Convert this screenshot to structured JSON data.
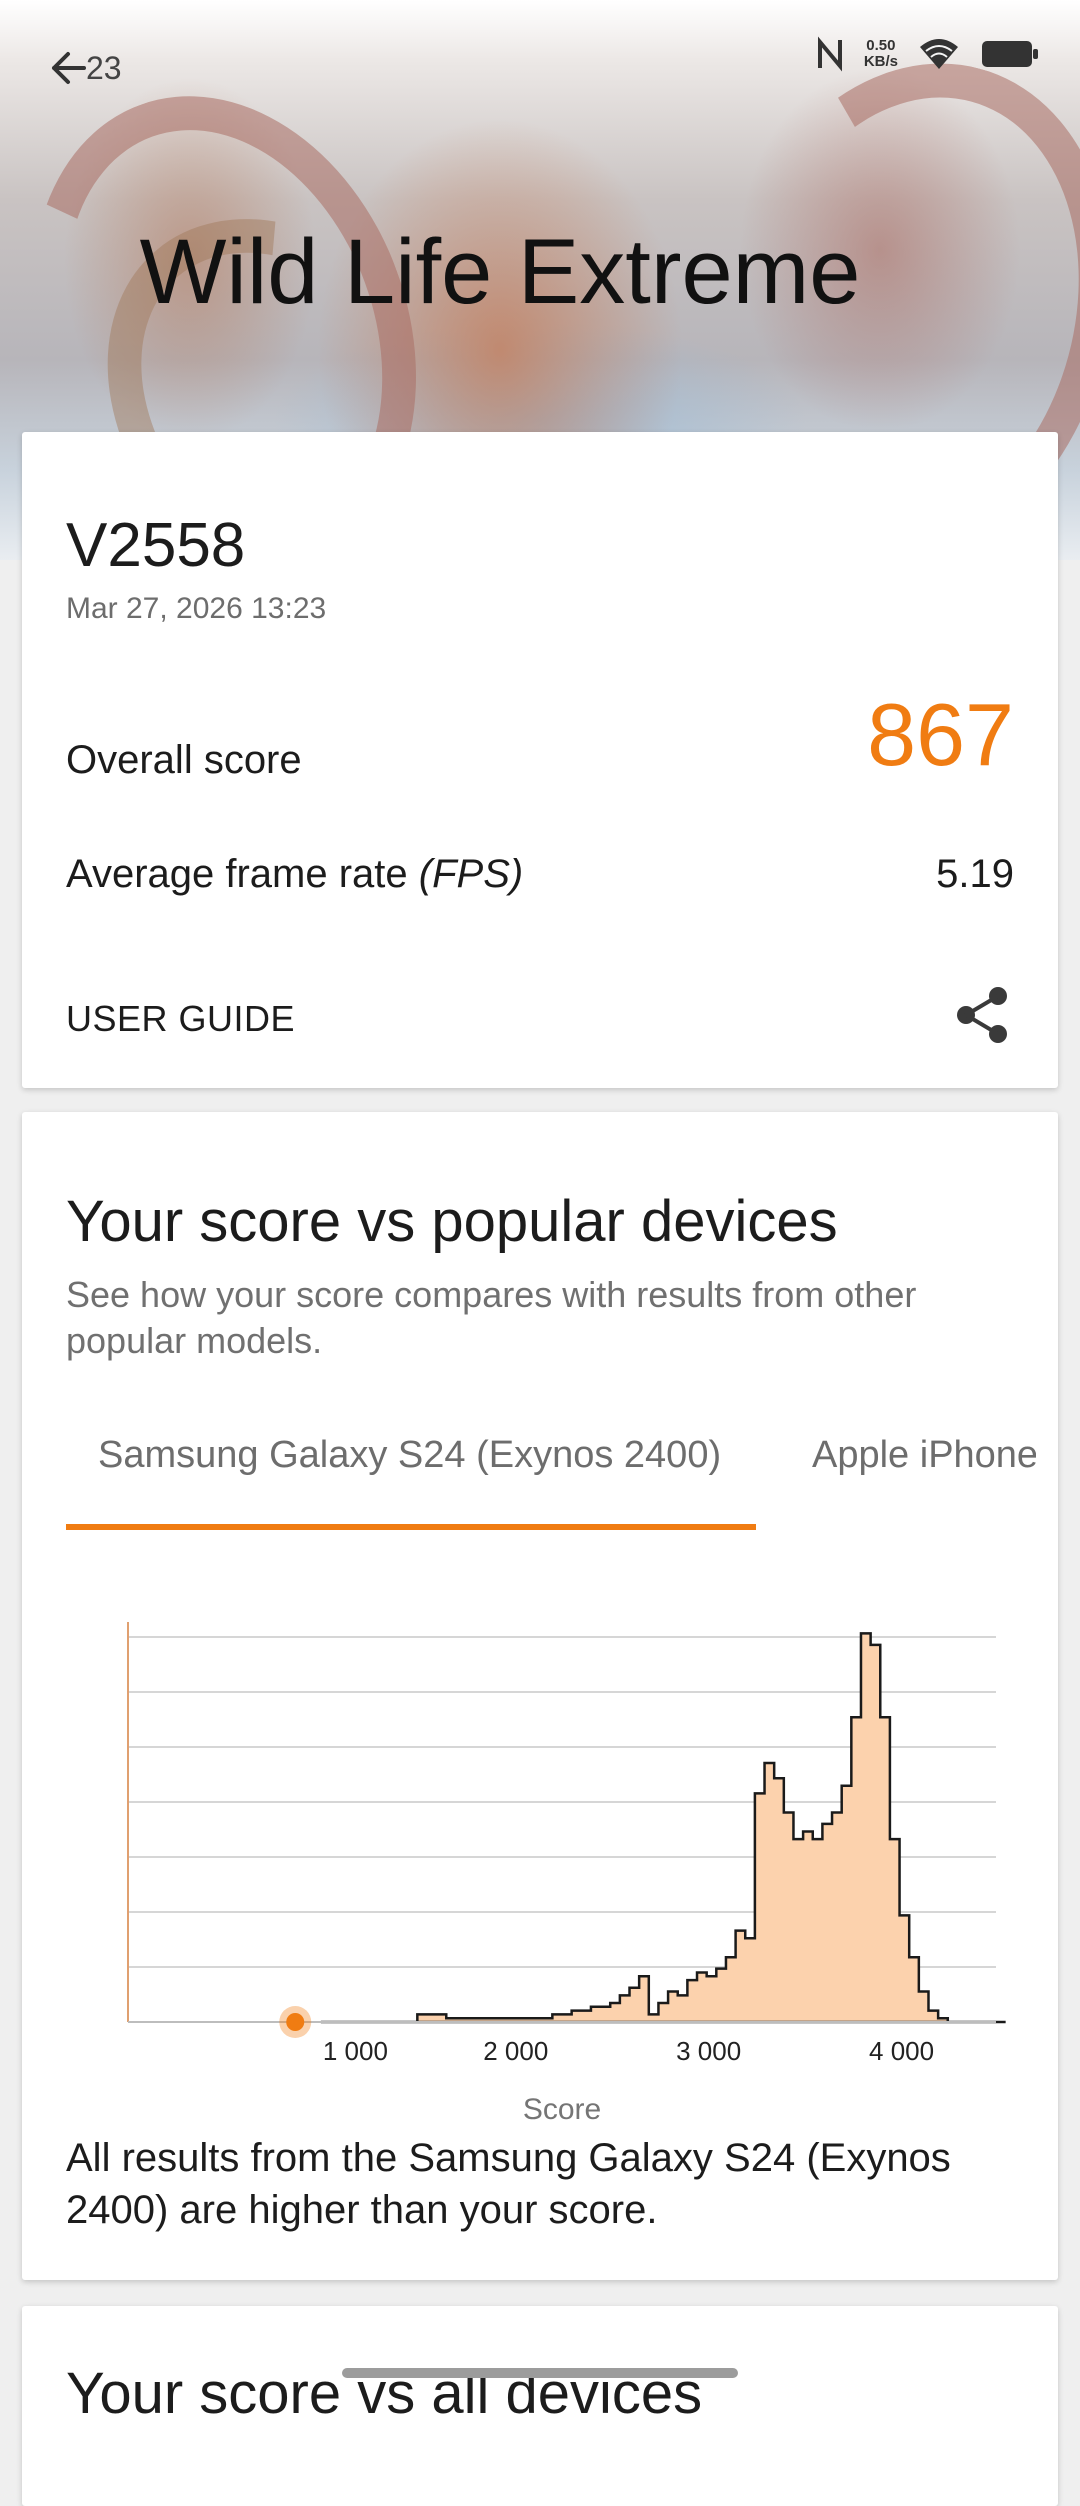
{
  "status_bar": {
    "time": "23",
    "net_speed_value": "0.50",
    "net_speed_unit": "KB/s",
    "icons": [
      "nfc-icon",
      "wifi-icon",
      "battery-icon"
    ]
  },
  "header": {
    "title": "Wild Life Extreme",
    "back_icon": "arrow-left-icon",
    "share_icon": "share-icon"
  },
  "result": {
    "device": "V2558",
    "date": "Mar 27, 2026 13:23",
    "overall_label": "Overall score",
    "overall_value": "867",
    "fps_label": "Average frame rate",
    "fps_unit": "(FPS)",
    "fps_value": "5.19",
    "user_guide": "USER GUIDE",
    "accent_color": "#f07c12"
  },
  "comparison": {
    "title": "Your score vs popular devices",
    "description": "See how your score compares with results from other popular models.",
    "tabs": [
      {
        "label": "Samsung Galaxy S24 (Exynos 2400)",
        "selected": true
      },
      {
        "label": "Apple iPhone",
        "selected": false
      }
    ],
    "note": "All results from the Samsung Galaxy S24 (Exynos 2400) are higher than your score."
  },
  "chart_data": {
    "type": "area",
    "title": "",
    "xlabel": "Score",
    "ylabel": "",
    "xlim": [
      0.0,
      4500
    ],
    "ylim": [
      0,
      105
    ],
    "x_ticks": [
      1000,
      2000,
      3000,
      4000
    ],
    "x_tick_labels": [
      "1 000",
      "2 000",
      "3 000",
      "4 000"
    ],
    "grid": true,
    "fill_color": "#fcd2ad",
    "line_color": "#1a1a1a",
    "your_score": 867,
    "marker_color": "#f07c12",
    "x": [
      1000,
      1500,
      1650,
      2000,
      2200,
      2300,
      2400,
      2450,
      2500,
      2550,
      2600,
      2650,
      2700,
      2750,
      2800,
      2850,
      2900,
      2950,
      3000,
      3050,
      3100,
      3150,
      3200,
      3250,
      3300,
      3350,
      3400,
      3450,
      3500,
      3550,
      3600,
      3650,
      3700,
      3750,
      3800,
      3850,
      3900,
      3950,
      4000,
      4050,
      4100,
      4150,
      4200,
      4250,
      4300,
      4350,
      4400,
      4450,
      4500
    ],
    "values": [
      0,
      2,
      1,
      1,
      2,
      3,
      4,
      4,
      5,
      7,
      9,
      12,
      2,
      5,
      8,
      7,
      11,
      13,
      12,
      14,
      17,
      24,
      22,
      60,
      68,
      64,
      55,
      48,
      50,
      48,
      52,
      55,
      62,
      80,
      102,
      99,
      80,
      48,
      28,
      17,
      8,
      3,
      1,
      0,
      0,
      0,
      0,
      0,
      0
    ]
  },
  "next_card": {
    "title": "Your score vs all devices"
  }
}
